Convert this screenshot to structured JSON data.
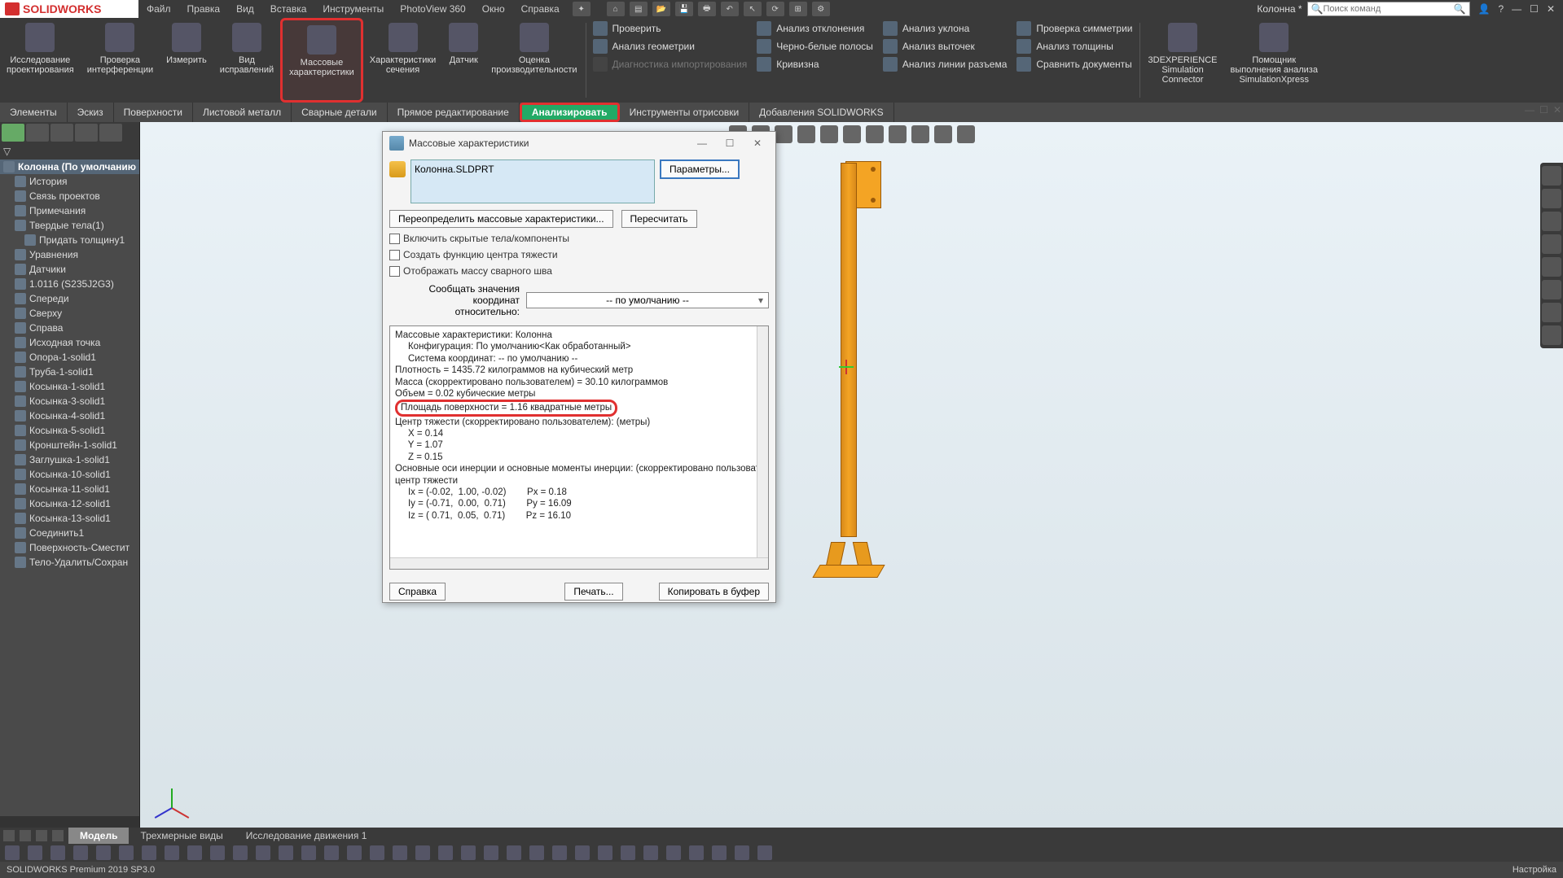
{
  "app": {
    "logo_text": "SOLIDWORKS"
  },
  "menubar": {
    "items": [
      "Файл",
      "Правка",
      "Вид",
      "Вставка",
      "Инструменты",
      "PhotoView 360",
      "Окно",
      "Справка"
    ],
    "doc_name": "Колонна *",
    "search_placeholder": "Поиск команд"
  },
  "ribbon": {
    "large": [
      {
        "label": "Исследование\nпроектирования"
      },
      {
        "label": "Проверка\nинтерференции"
      },
      {
        "label": "Измерить"
      },
      {
        "label": "Вид\nисправлений"
      },
      {
        "label": "Массовые\nхарактеристики",
        "boxed": true
      },
      {
        "label": "Характеристики\nсечения"
      },
      {
        "label": "Датчик"
      },
      {
        "label": "Оценка\nпроизводительности"
      }
    ],
    "mini_cols": [
      [
        {
          "label": "Проверить"
        },
        {
          "label": "Анализ геометрии"
        },
        {
          "label": "Диагностика импортирования",
          "dim": true
        }
      ],
      [
        {
          "label": "Анализ отклонения"
        },
        {
          "label": "Черно-белые полосы"
        },
        {
          "label": "Кривизна"
        }
      ],
      [
        {
          "label": "Анализ уклона"
        },
        {
          "label": "Анализ выточек"
        },
        {
          "label": "Анализ линии разъема"
        }
      ],
      [
        {
          "label": "Проверка симметрии"
        },
        {
          "label": "Анализ толщины"
        },
        {
          "label": "Сравнить документы"
        }
      ]
    ],
    "right_large": [
      {
        "label": "3DEXPERIENCE\nSimulation\nConnector"
      },
      {
        "label": "Помощник\nвыполнения анализа\nSimulationXpress"
      }
    ]
  },
  "tabs": [
    "Элементы",
    "Эскиз",
    "Поверхности",
    "Листовой металл",
    "Сварные детали",
    "Прямое редактирование",
    "Анализировать",
    "Инструменты отрисовки",
    "Добавления SOLIDWORKS"
  ],
  "active_tab_index": 6,
  "tree": {
    "root": "Колонна  (По умолчанию",
    "items": [
      "История",
      "Связь проектов",
      "Примечания",
      "Твердые тела(1)",
      "   Придать толщину1",
      "Уравнения",
      "Датчики",
      "1.0116 (S235J2G3)",
      "Спереди",
      "Сверху",
      "Справа",
      "Исходная точка",
      "Опора-1-solid1",
      "Труба-1-solid1",
      "Косынка-1-solid1",
      "Косынка-3-solid1",
      "Косынка-4-solid1",
      "Косынка-5-solid1",
      "Кронштейн-1-solid1",
      "Заглушка-1-solid1",
      "Косынка-10-solid1",
      "Косынка-11-solid1",
      "Косынка-12-solid1",
      "Косынка-13-solid1",
      "Соединить1",
      "Поверхность-Сместит",
      "Тело-Удалить/Сохран"
    ]
  },
  "dialog": {
    "title": "Массовые характеристики",
    "filename": "Колонна.SLDPRT",
    "btn_params": "Параметры...",
    "btn_override": "Переопределить массовые характеристики...",
    "btn_recalc": "Пересчитать",
    "chk_hidden": "Включить скрытые тела/компоненты",
    "chk_com": "Создать функцию центра тяжести",
    "chk_weld": "Отображать массу сварного шва",
    "coord_label": "Сообщать значения координат\nотносительно:",
    "coord_value": "-- по умолчанию --",
    "results": [
      "Массовые характеристики: Колонна",
      "     Конфигурация: По умолчанию<Как обработанный>",
      "     Система координат: -- по умолчанию --",
      "",
      "Плотность = 1435.72 килограммов на кубический метр",
      "",
      "Масса (скорректировано пользователем) = 30.10 килограммов",
      "",
      "Объем = 0.02 кубические метры",
      "",
      "Площадь поверхности = 1.16 квадратные метры",
      "",
      "Центр тяжести (скорректировано пользователем): (метры)",
      "     X = 0.14",
      "     Y = 1.07",
      "     Z = 0.15",
      "",
      "Основные оси инерции и основные моменты инерции: (скорректировано пользовате",
      "центр тяжести",
      "     Ix = (-0.02,  1.00, -0.02)        Px = 0.18",
      "     Iy = (-0.71,  0.00,  0.71)        Py = 16.09",
      "     Iz = ( 0.71,  0.05,  0.71)        Pz = 16.10"
    ],
    "results_highlight_index": 10,
    "btn_help": "Справка",
    "btn_print": "Печать...",
    "btn_copy": "Копировать в буфер"
  },
  "bottom_tabs": [
    "Модель",
    "Трехмерные виды",
    "Исследование движения 1"
  ],
  "bottom_active": 0,
  "status": {
    "left": "SOLIDWORKS Premium 2019 SP3.0",
    "right": "Настройка"
  }
}
